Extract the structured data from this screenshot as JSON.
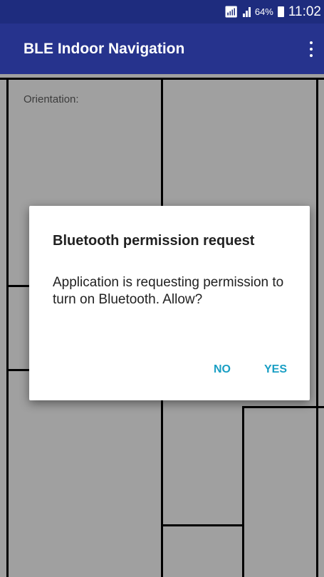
{
  "status_bar": {
    "wifi_icon": "wifi-icon",
    "signal_icon": "signal-icon",
    "battery_percent": "64%",
    "battery_icon": "battery-icon",
    "time": "11:02"
  },
  "app_bar": {
    "title": "BLE Indoor Navigation",
    "menu_icon": "overflow-menu-icon"
  },
  "map": {
    "orientation_label": "Orientation:"
  },
  "dialog": {
    "title": "Bluetooth permission request",
    "message": "Application is requesting permission to turn on Bluetooth. Allow?",
    "no_label": "NO",
    "yes_label": "YES"
  },
  "colors": {
    "status_bar": "#1e2c7e",
    "app_bar": "#26338d",
    "map_background": "#a9a9a9",
    "dialog_button": "#1a9fc4"
  }
}
